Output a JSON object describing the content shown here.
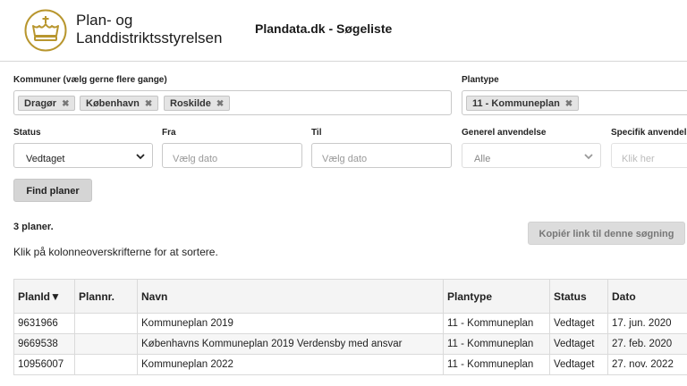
{
  "header": {
    "org_name_line1": "Plan- og",
    "org_name_line2": "Landdistriktsstyrelsen",
    "app_title": "Plandata.dk - Søgeliste",
    "crown_icon": "crown-icon",
    "brand_color": "#b8962e"
  },
  "filters": {
    "kommuner": {
      "label": "Kommuner (vælg gerne flere gange)",
      "chips": [
        "Dragør",
        "København",
        "Roskilde"
      ]
    },
    "plantype": {
      "label": "Plantype",
      "chips": [
        "11 - Kommuneplan"
      ]
    },
    "status": {
      "label": "Status",
      "value": "Vedtaget"
    },
    "fra": {
      "label": "Fra",
      "placeholder": "Vælg dato"
    },
    "til": {
      "label": "Til",
      "placeholder": "Vælg dato"
    },
    "generel_anvendelse": {
      "label": "Generel anvendelse",
      "value": "Alle"
    },
    "specifik_anvendelse": {
      "label": "Specifik anvendelse",
      "placeholder": "Klik her"
    },
    "find_button": "Find planer"
  },
  "results": {
    "count_text": "3 planer.",
    "hint": "Klik på kolonneoverskrifterne for at sortere.",
    "copy_link_button": "Kopiér link til denne søgning",
    "columns": [
      "PlanId▼",
      "Plannr.",
      "Navn",
      "Plantype",
      "Status",
      "Dato"
    ],
    "rows": [
      [
        "9631966",
        "",
        "Kommuneplan 2019",
        "11 - Kommuneplan",
        "Vedtaget",
        "17. jun. 2020"
      ],
      [
        "9669538",
        "",
        "Københavns Kommuneplan 2019 Verdensby med ansvar",
        "11 - Kommuneplan",
        "Vedtaget",
        "27. feb. 2020"
      ],
      [
        "10956007",
        "",
        "Kommuneplan 2022",
        "11 - Kommuneplan",
        "Vedtaget",
        "27. nov. 2022"
      ]
    ]
  }
}
